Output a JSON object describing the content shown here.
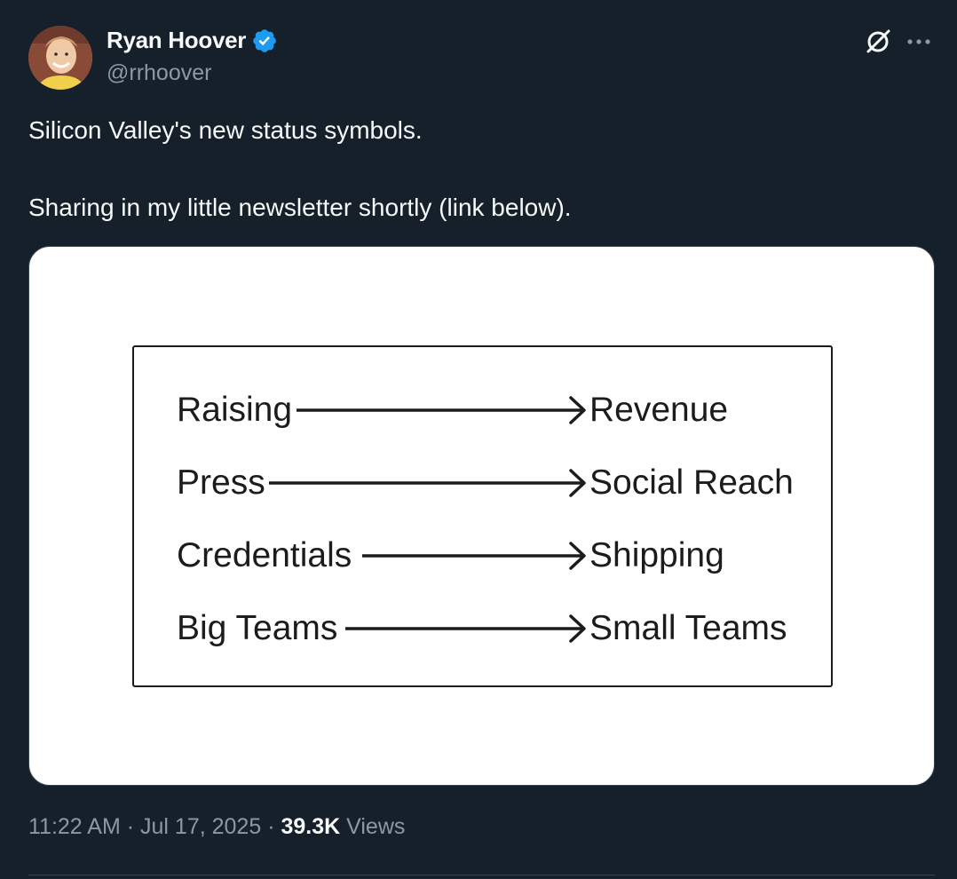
{
  "author": {
    "name": "Ryan Hoover",
    "handle": "@rrhoover",
    "verified": true
  },
  "tweet": {
    "line1": "Silicon Valley's new status symbols.",
    "line2": "Sharing in my little newsletter shortly (link below)."
  },
  "image": {
    "mappings": [
      {
        "from": "Raising",
        "to": "Revenue"
      },
      {
        "from": "Press",
        "to": "Social Reach"
      },
      {
        "from": "Credentials",
        "to": "Shipping"
      },
      {
        "from": "Big Teams",
        "to": "Small Teams"
      }
    ]
  },
  "meta": {
    "time": "11:22 AM",
    "sep1": "·",
    "date": "Jul 17, 2025",
    "sep2": "·",
    "views_count": "39.3K",
    "views_label": "Views"
  },
  "icons": {
    "verified": "verified-badge-icon",
    "grok": "grok-icon",
    "more": "more-icon"
  },
  "colors": {
    "background": "#15202b",
    "text_primary": "#f7f9f9",
    "text_secondary": "#8b98a5",
    "verified_blue": "#1d9bf0"
  }
}
